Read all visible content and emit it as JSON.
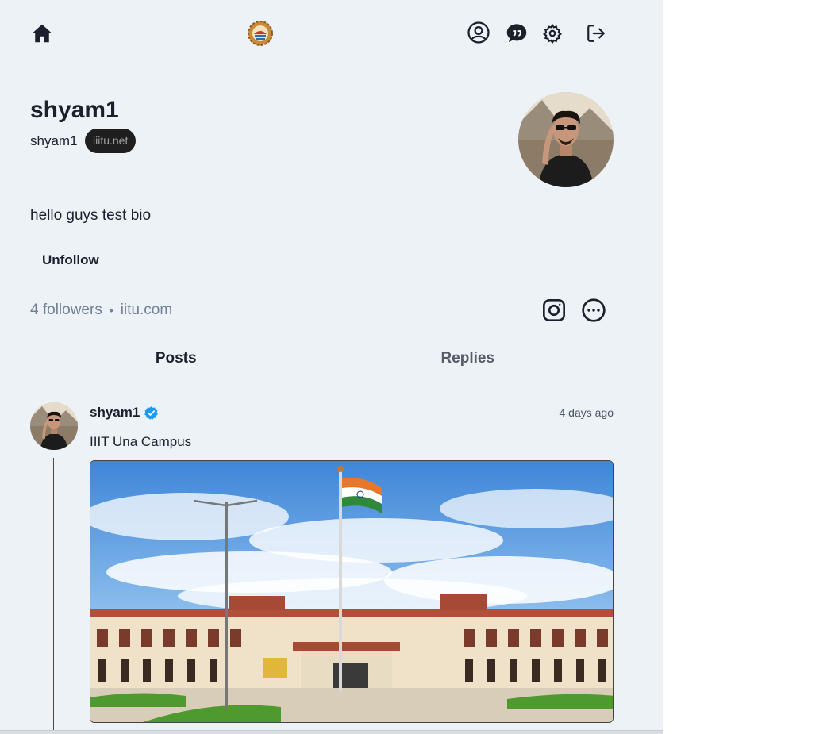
{
  "header": {
    "home_icon": "home-icon",
    "logo_icon": "iiit-una-logo",
    "profile_icon": "user-circle-icon",
    "chat_icon": "chat-bubble-icon",
    "settings_icon": "gear-icon",
    "logout_icon": "logout-icon"
  },
  "profile": {
    "name": "shyam1",
    "username": "shyam1",
    "domain_badge": "iiitu.net",
    "bio": "hello guys test bio",
    "follow_button": "Unfollow",
    "followers": "4 followers",
    "separator": "•",
    "link": "iitu.com",
    "social_icons": [
      "instagram-icon",
      "more-icon"
    ]
  },
  "tabs": {
    "posts": "Posts",
    "replies": "Replies",
    "active": "Posts"
  },
  "post": {
    "username": "shyam1",
    "verified": true,
    "time": "4 days ago",
    "text": "IIIT Una Campus"
  },
  "colors": {
    "background": "#edf2f7",
    "verified_blue": "#1d9bf0",
    "badge_bg": "#1f1f1f",
    "text_primary": "#1a202c",
    "text_muted": "#718096"
  }
}
